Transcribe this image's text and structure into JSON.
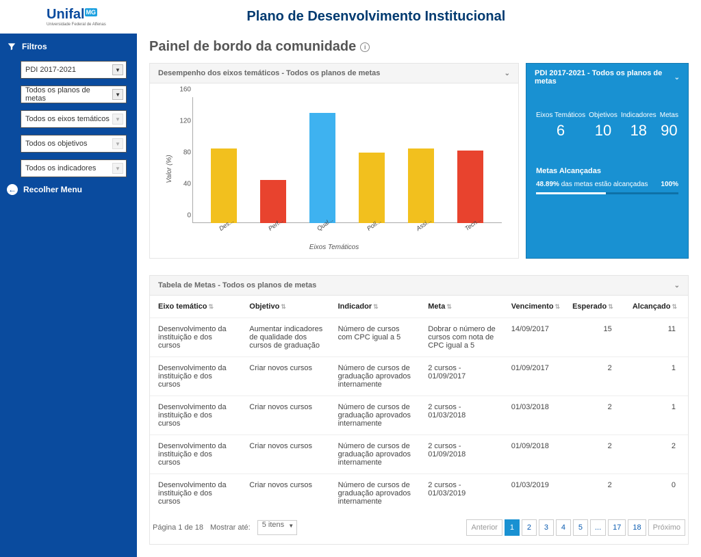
{
  "logo": {
    "main": "Unifal",
    "accent": "MG",
    "sub": "Universidade Federal de Alfenas"
  },
  "app_title": "Plano de Desenvolvimento Institucional",
  "sidebar": {
    "filters_label": "Filtros",
    "selects": [
      "PDI 2017-2021",
      "Todos os planos de metas",
      "Todos os eixos temáticos",
      "Todos os objetivos",
      "Todos os indicadores"
    ],
    "collapse_label": "Recolher Menu"
  },
  "page_title": "Painel de bordo da comunidade",
  "chart_card_title": "Desempenho dos eixos temáticos - Todos os planos de metas",
  "chart_data": {
    "type": "bar",
    "ylabel": "Valor (%)",
    "xlabel": "Eixos Temáticos",
    "ylim": [
      0,
      160
    ],
    "y_ticks": [
      0,
      40,
      80,
      120,
      160
    ],
    "categories": [
      "Des...",
      "Perf...",
      "Qual...",
      "Polí...",
      "Assi...",
      "Tecn..."
    ],
    "values": [
      95,
      55,
      140,
      90,
      95,
      92
    ],
    "colors": [
      "#f2c01e",
      "#e8432e",
      "#3eb2f0",
      "#f2c01e",
      "#f2c01e",
      "#e8432e"
    ]
  },
  "stats_card": {
    "title": "PDI 2017-2021 - Todos os planos de metas",
    "cols": [
      {
        "label": "Eixos Temáticos",
        "value": "6"
      },
      {
        "label": "Objetivos",
        "value": "10"
      },
      {
        "label": "Indicadores",
        "value": "18"
      },
      {
        "label": "Metas",
        "value": "90"
      }
    ],
    "goals_title": "Metas Alcançadas",
    "goals_pct_label": "48.89%",
    "goals_text": "das metas estão alcançadas",
    "goals_right": "100%",
    "progress_pct": 48.89
  },
  "table_card_title": "Tabela de Metas - Todos os planos de metas",
  "table": {
    "headers": [
      "Eixo temático",
      "Objetivo",
      "Indicador",
      "Meta",
      "Vencimento",
      "Esperado",
      "Alcançado"
    ],
    "rows": [
      {
        "eixo": "Desenvolvimento da instituição e dos cursos",
        "obj": "Aumentar indicadores de qualidade dos cursos de graduação",
        "ind": "Número de cursos com CPC igual a 5",
        "meta": "Dobrar o número de cursos com nota de CPC igual a 5",
        "venc": "14/09/2017",
        "esp": "15",
        "alc": "11"
      },
      {
        "eixo": "Desenvolvimento da instituição e dos cursos",
        "obj": "Criar novos cursos",
        "ind": "Número de cursos de graduação aprovados internamente",
        "meta": "2 cursos - 01/09/2017",
        "venc": "01/09/2017",
        "esp": "2",
        "alc": "1"
      },
      {
        "eixo": "Desenvolvimento da instituição e dos cursos",
        "obj": "Criar novos cursos",
        "ind": "Número de cursos de graduação aprovados internamente",
        "meta": "2 cursos - 01/03/2018",
        "venc": "01/03/2018",
        "esp": "2",
        "alc": "1"
      },
      {
        "eixo": "Desenvolvimento da instituição e dos cursos",
        "obj": "Criar novos cursos",
        "ind": "Número de cursos de graduação aprovados internamente",
        "meta": "2 cursos - 01/09/2018",
        "venc": "01/09/2018",
        "esp": "2",
        "alc": "2"
      },
      {
        "eixo": "Desenvolvimento da instituição e dos cursos",
        "obj": "Criar novos cursos",
        "ind": "Número de cursos de graduação aprovados internamente",
        "meta": "2 cursos - 01/03/2019",
        "venc": "01/03/2019",
        "esp": "2",
        "alc": "0"
      }
    ]
  },
  "pager": {
    "page_text": "Página 1 de 18",
    "show_label": "Mostrar até:",
    "show_value": "5 itens",
    "prev": "Anterior",
    "next": "Próximo",
    "pages": [
      "1",
      "2",
      "3",
      "4",
      "5",
      "...",
      "17",
      "18"
    ]
  }
}
